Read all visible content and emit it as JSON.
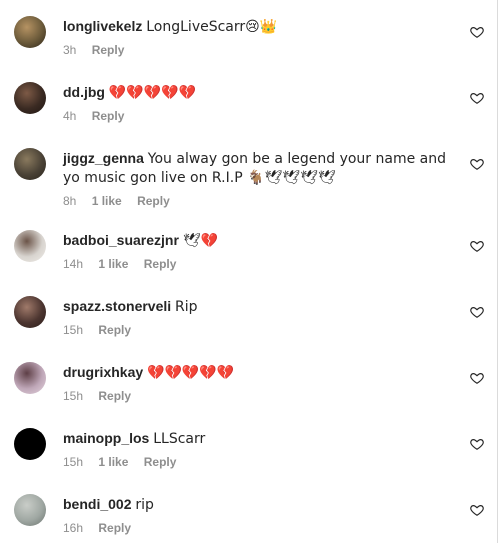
{
  "comments": [
    {
      "username": "longlivekelz",
      "text": "LongLiveScarr😢👑",
      "time": "3h",
      "likes": "",
      "reply": "Reply",
      "avatar_colors": [
        "#6b5a3a",
        "#b69363",
        "#2c2418"
      ]
    },
    {
      "username": "dd.jbg",
      "text": "💔💔💔💔💔",
      "time": "4h",
      "likes": "",
      "reply": "Reply",
      "avatar_colors": [
        "#3a2a22",
        "#7d5a46",
        "#1e1512"
      ]
    },
    {
      "username": "jiggz_genna",
      "text": "You alway gon be a legend your name and yo music gon live on R.I.P 🐐🕊🕊🕊🕊",
      "time": "8h",
      "likes": "1 like",
      "reply": "Reply",
      "avatar_colors": [
        "#4a4236",
        "#8a7a5e",
        "#2a241c"
      ]
    },
    {
      "username": "badboi_suarezjnr",
      "text": "🕊💔",
      "time": "14h",
      "likes": "1 like",
      "reply": "Reply",
      "avatar_colors": [
        "#d8d4cf",
        "#6b5448",
        "#f0ede8"
      ]
    },
    {
      "username": "spazz.stonerveli",
      "text": "Rip",
      "time": "15h",
      "likes": "",
      "reply": "Reply",
      "avatar_colors": [
        "#4c3530",
        "#a07a6a",
        "#2a1c18"
      ]
    },
    {
      "username": "drugrixhkay",
      "text": "💔💔💔💔💔",
      "time": "15h",
      "likes": "",
      "reply": "Reply",
      "avatar_colors": [
        "#bfa7b8",
        "#5e3f46",
        "#e4d4de"
      ]
    },
    {
      "username": "mainopp_los",
      "text": "LLScarr",
      "time": "15h",
      "likes": "1 like",
      "reply": "Reply",
      "avatar_colors": [
        "#000000",
        "#000000",
        "#000000"
      ]
    },
    {
      "username": "bendi_002",
      "text": "rip",
      "time": "16h",
      "likes": "",
      "reply": "Reply",
      "avatar_colors": [
        "#9fa7a2",
        "#c9cdc8",
        "#6a736e"
      ]
    }
  ],
  "icons": {
    "like": "heart-outline-icon"
  },
  "colors": {
    "text": "#262626",
    "meta": "#8e8e8e",
    "background": "#ffffff"
  }
}
